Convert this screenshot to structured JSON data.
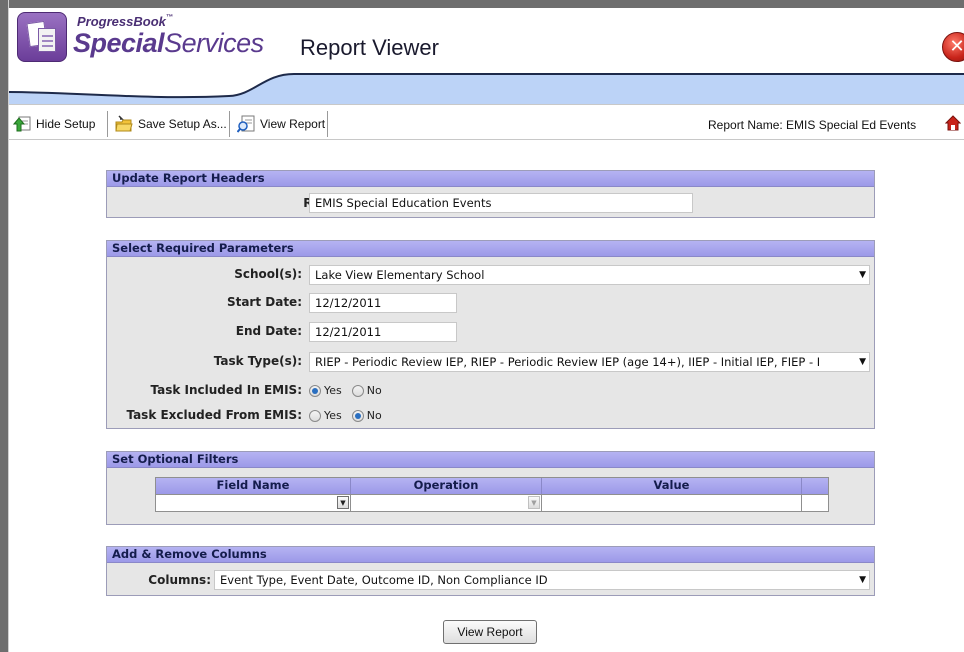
{
  "brand": {
    "small": "ProgressBook",
    "small_tm": "™",
    "big_bold": "Special",
    "big_regular": "Services",
    "accent": "#5a3a8e"
  },
  "header": {
    "title": "Report Viewer",
    "close_icon": "close-icon"
  },
  "toolbar": {
    "hide_setup": "Hide Setup",
    "save_setup_as": "Save Setup As...",
    "view_report": "View Report",
    "report_name_label": "Report Name:",
    "report_name_value": "EMIS Special Ed Events"
  },
  "update_headers": {
    "title": "Update Report Headers",
    "report_header_label": "Report Header:",
    "report_header_value": "EMIS Special Education Events"
  },
  "required_params": {
    "title": "Select Required Parameters",
    "schools_label": "School(s):",
    "schools_value": "Lake View Elementary School",
    "start_date_label": "Start Date:",
    "start_date_value": "12/12/2011",
    "end_date_label": "End Date:",
    "end_date_value": "12/21/2011",
    "task_types_label": "Task Type(s):",
    "task_types_value": "RIEP - Periodic Review IEP, RIEP - Periodic Review IEP (age 14+), IIEP - Initial IEP, FIEP - I",
    "included_label": "Task Included In EMIS:",
    "included_selected": "Yes",
    "excluded_label": "Task Excluded From EMIS:",
    "excluded_selected": "No",
    "yes": "Yes",
    "no": "No"
  },
  "optional_filters": {
    "title": "Set Optional Filters",
    "columns": [
      "Field Name",
      "Operation",
      "Value"
    ]
  },
  "columns_section": {
    "title": "Add & Remove Columns",
    "columns_label": "Columns:",
    "columns_value": "Event Type, Event Date, Outcome ID, Non Compliance ID"
  },
  "footer": {
    "view_report_button": "View Report"
  }
}
